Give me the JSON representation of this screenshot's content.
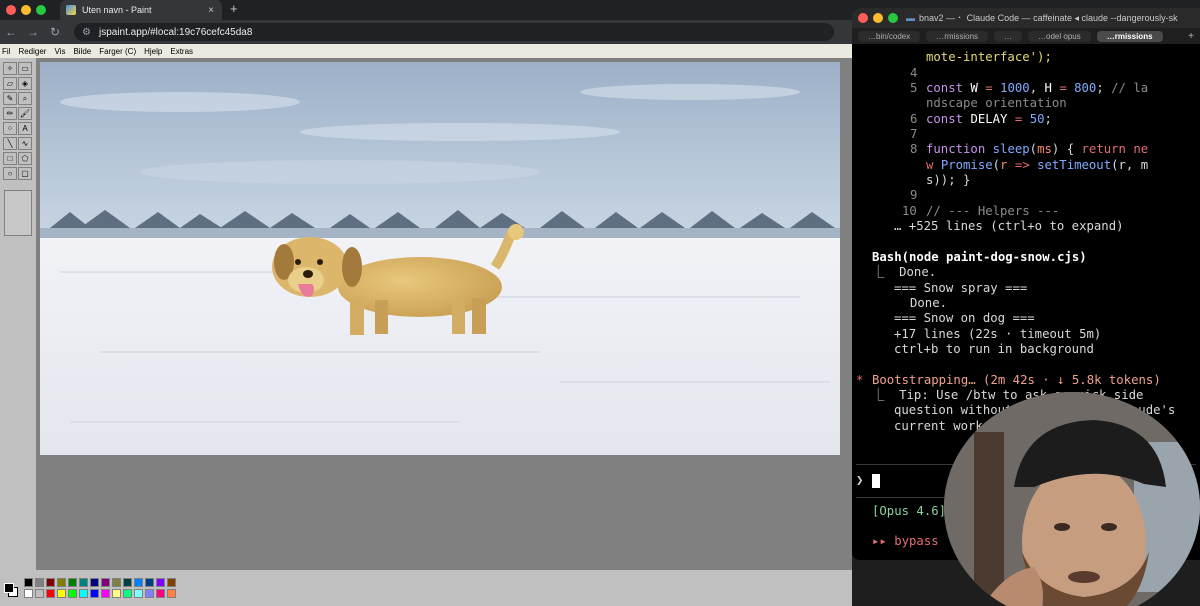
{
  "browser": {
    "tab_title": "Uten navn - Paint",
    "tab_close": "×",
    "new_tab": "+",
    "back": "←",
    "forward": "→",
    "reload": "↻",
    "url": "jspaint.app/#local:19c76cefc45da8"
  },
  "paint": {
    "menu": [
      "Fil",
      "Rediger",
      "Vis",
      "Bilde",
      "Farger (C)",
      "Hjelp",
      "Extras"
    ],
    "tools": [
      "select-free",
      "select-rect",
      "eraser",
      "fill",
      "color-picker",
      "magnifier",
      "pencil",
      "brush",
      "airbrush",
      "text",
      "line",
      "curve",
      "rectangle",
      "polygon",
      "ellipse",
      "rounded-rectangle"
    ],
    "palette": [
      "#000000",
      "#808080",
      "#800000",
      "#808000",
      "#008000",
      "#008080",
      "#000080",
      "#800080",
      "#808040",
      "#004040",
      "#0080ff",
      "#004080",
      "#8000ff",
      "#804000",
      "#ffffff",
      "#c0c0c0",
      "#ff0000",
      "#ffff00",
      "#00ff00",
      "#00ffff",
      "#0000ff",
      "#ff00ff",
      "#ffff80",
      "#00ff80",
      "#80ffff",
      "#8080ff",
      "#ff0080",
      "#ff8040"
    ],
    "foreground": "#000000",
    "background": "#ffffff"
  },
  "terminal": {
    "title": "bnav2 — ⠂ Claude Code — caffeinate ◂ claude --dangerously-sk",
    "tabs": [
      "…bin/codex",
      "…rmissions",
      "…",
      "…odel opus",
      "…rmissions"
    ],
    "active_tab": 4,
    "add_tab": "+",
    "lines": {
      "l1": "mote-interface');",
      "n4": "4",
      "n5": "5",
      "l5a": "const W = 1000, H = 800; // la",
      "l5b": "ndscape orientation",
      "n6": "6",
      "l6": "const DELAY = 50;",
      "n7": "7",
      "n8": "8",
      "l8a": "function sleep(ms) { return ne",
      "l8b": "w Promise(r => setTimeout(r, m",
      "l8c": "s)); }",
      "n9": "9",
      "n10": "10",
      "l10": "// --- Helpers ---",
      "more": "… +525 lines (ctrl+o to expand)",
      "bash_cmd": "Bash(node paint-dog-snow.cjs)",
      "done1": "⎿  Done.",
      "spray": "=== Snow spray ===",
      "done2": "Done.",
      "dog": "=== Snow on dog ===",
      "plus17": "+17 lines (22s · timeout 5m)",
      "ctrlb": "ctrl+b to run in background",
      "boot_star": "*",
      "boot": "Bootstrapping… (2m 42s · ↓ 5.8k tokens)",
      "tip1": "⎿  Tip: Use /btw to ask a quick side",
      "tip2": "question without interrupting Claude's",
      "tip3": "current work",
      "prompt": "❯",
      "model": "[Opus 4.6]",
      "bypass": "▸▸ bypass"
    }
  }
}
